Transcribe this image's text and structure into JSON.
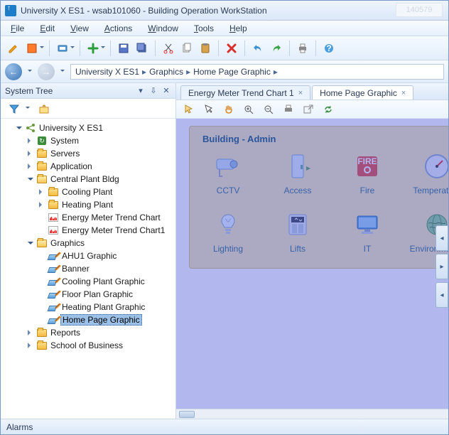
{
  "window": {
    "title": "University X ES1 - wsab101060 - Building Operation WorkStation",
    "ghost": "140579"
  },
  "menu": {
    "items": [
      "File",
      "Edit",
      "View",
      "Actions",
      "Window",
      "Tools",
      "Help"
    ]
  },
  "breadcrumb": {
    "items": [
      "University X ES1",
      "Graphics",
      "Home Page Graphic"
    ]
  },
  "leftPanel": {
    "title": "System Tree"
  },
  "tree": {
    "root": "University X ES1",
    "nodes": [
      {
        "d": 1,
        "t": "open",
        "i": "root",
        "l": "University X ES1"
      },
      {
        "d": 2,
        "t": "closed",
        "i": "srv",
        "l": "System"
      },
      {
        "d": 2,
        "t": "closed",
        "i": "folder",
        "l": "Servers"
      },
      {
        "d": 2,
        "t": "closed",
        "i": "folder",
        "l": "Application"
      },
      {
        "d": 2,
        "t": "open",
        "i": "folder-open",
        "l": "Central Plant Bldg"
      },
      {
        "d": 3,
        "t": "closed",
        "i": "folder",
        "l": "Cooling Plant"
      },
      {
        "d": 3,
        "t": "closed",
        "i": "folder",
        "l": "Heating Plant"
      },
      {
        "d": 3,
        "t": "none",
        "i": "chart",
        "l": "Energy Meter Trend Chart"
      },
      {
        "d": 3,
        "t": "none",
        "i": "chart",
        "l": "Energy Meter Trend Chart1"
      },
      {
        "d": 2,
        "t": "open",
        "i": "folder-open",
        "l": "Graphics"
      },
      {
        "d": 3,
        "t": "none",
        "i": "graphic",
        "l": "AHU1 Graphic"
      },
      {
        "d": 3,
        "t": "none",
        "i": "graphic",
        "l": "Banner"
      },
      {
        "d": 3,
        "t": "none",
        "i": "graphic",
        "l": "Cooling Plant Graphic"
      },
      {
        "d": 3,
        "t": "none",
        "i": "graphic",
        "l": "Floor Plan Graphic"
      },
      {
        "d": 3,
        "t": "none",
        "i": "graphic",
        "l": "Heating Plant Graphic"
      },
      {
        "d": 3,
        "t": "none",
        "i": "graphic",
        "l": "Home Page Graphic",
        "sel": true
      },
      {
        "d": 2,
        "t": "closed",
        "i": "folder",
        "l": "Reports"
      },
      {
        "d": 2,
        "t": "closed",
        "i": "folder",
        "l": "School of Business"
      }
    ]
  },
  "tabs": [
    {
      "label": "Energy Meter Trend Chart 1",
      "active": false
    },
    {
      "label": "Home Page Graphic",
      "active": true
    }
  ],
  "card": {
    "title": "Building - Admin",
    "row1": [
      "CCTV",
      "Access",
      "Fire",
      "Temperature"
    ],
    "row2": [
      "Lighting",
      "Lifts",
      "IT",
      "Environmental"
    ]
  },
  "alarms": {
    "label": "Alarms"
  }
}
